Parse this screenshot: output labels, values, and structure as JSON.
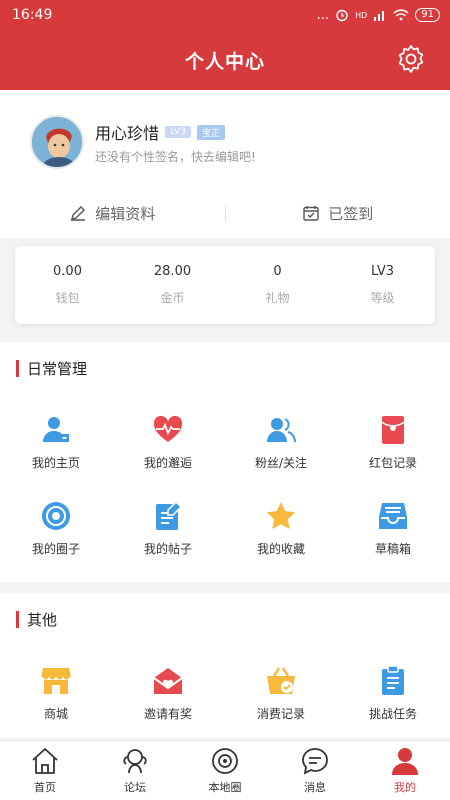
{
  "status": {
    "time": "16:49",
    "dots": "...",
    "signal": "HD",
    "battery": "91"
  },
  "header": {
    "title": "个人中心"
  },
  "profile": {
    "name": "用心珍惜",
    "level_tag": "LV3",
    "verified_tag": "宝正",
    "signature": "还没有个性签名，快去编辑吧!",
    "edit_label": "编辑资料",
    "checkin_label": "已签到"
  },
  "stats": [
    {
      "value": "0.00",
      "label": "钱包"
    },
    {
      "value": "28.00",
      "label": "金币"
    },
    {
      "value": "0",
      "label": "礼物"
    },
    {
      "value": "LV3",
      "label": "等级"
    }
  ],
  "daily": {
    "title": "日常管理",
    "items": [
      {
        "label": "我的主页",
        "icon": "user-home-icon"
      },
      {
        "label": "我的邂逅",
        "icon": "heartbeat-icon"
      },
      {
        "label": "粉丝/关注",
        "icon": "fans-icon"
      },
      {
        "label": "红包记录",
        "icon": "red-envelope-icon"
      },
      {
        "label": "我的圈子",
        "icon": "circle-target-icon"
      },
      {
        "label": "我的帖子",
        "icon": "post-icon"
      },
      {
        "label": "我的收藏",
        "icon": "star-icon"
      },
      {
        "label": "草稿箱",
        "icon": "drafts-icon"
      }
    ]
  },
  "other": {
    "title": "其他",
    "items": [
      {
        "label": "商城",
        "icon": "shop-icon"
      },
      {
        "label": "邀请有奖",
        "icon": "invite-mail-icon"
      },
      {
        "label": "消费记录",
        "icon": "basket-icon"
      },
      {
        "label": "挑战任务",
        "icon": "clipboard-icon"
      }
    ]
  },
  "tabs": [
    {
      "label": "首页",
      "icon": "home-icon"
    },
    {
      "label": "论坛",
      "icon": "forum-icon"
    },
    {
      "label": "本地圈",
      "icon": "local-circle-icon"
    },
    {
      "label": "消息",
      "icon": "message-icon"
    },
    {
      "label": "我的",
      "icon": "profile-icon",
      "active": true
    }
  ],
  "colors": {
    "brand": "#d63a3c",
    "icon_blue": "#3d9ae3",
    "icon_red": "#e84a4f",
    "icon_yellow": "#f6b93b"
  }
}
